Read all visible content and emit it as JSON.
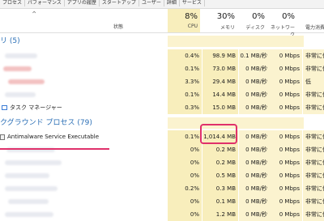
{
  "tabs": [
    "プロセス",
    "パフォーマンス",
    "アプリの履歴",
    "スタートアップ",
    "ユーザー",
    "詳細",
    "サービス"
  ],
  "header": {
    "status_label": "状態",
    "cpu": {
      "pct": "8%",
      "label": "CPU"
    },
    "memory": {
      "pct": "30%",
      "label": "メモリ"
    },
    "disk": {
      "pct": "0%",
      "label": "ディスク"
    },
    "network": {
      "pct": "0%",
      "label": "ネットワーク"
    },
    "power": {
      "label": "電力消費"
    }
  },
  "groups": {
    "apps": "リ (5)",
    "background": "クグラウンド プロセス (79)"
  },
  "app_rows": [
    {
      "name": "",
      "cpu": "0.4%",
      "mem": "98.9 MB",
      "disk": "0.1 MB/秒",
      "net": "0 Mbps",
      "power": "非常に低"
    },
    {
      "name": "",
      "cpu": "0.1%",
      "mem": "73.0 MB",
      "disk": "0 MB/秒",
      "net": "0 Mbps",
      "power": "非常に低"
    },
    {
      "name": "",
      "cpu": "3.3%",
      "mem": "29.4 MB",
      "disk": "0 MB/秒",
      "net": "0 Mbps",
      "power": "低"
    },
    {
      "name": "",
      "cpu": "0.1%",
      "mem": "14.4 MB",
      "disk": "0 MB/秒",
      "net": "0 Mbps",
      "power": "非常に低"
    },
    {
      "name": "タスク マネージャー",
      "cpu": "0.3%",
      "mem": "15.0 MB",
      "disk": "0 MB/秒",
      "net": "0 Mbps",
      "power": "非常に低"
    }
  ],
  "bg_rows": [
    {
      "name": "Antimalware Service Executable",
      "cpu": "0.1%",
      "mem": "1,014.4 MB",
      "disk": "0 MB/秒",
      "net": "0 Mbps",
      "power": "非常に低"
    },
    {
      "name": "",
      "cpu": "0%",
      "mem": "0.2 MB",
      "disk": "0 MB/秒",
      "net": "0 Mbps",
      "power": "非常に低"
    },
    {
      "name": "",
      "cpu": "0%",
      "mem": "0.2 MB",
      "disk": "0 MB/秒",
      "net": "0 Mbps",
      "power": "非常に低"
    },
    {
      "name": "",
      "cpu": "0%",
      "mem": "0.5 MB",
      "disk": "0 MB/秒",
      "net": "0 Mbps",
      "power": "非常に低"
    },
    {
      "name": "",
      "cpu": "0.2%",
      "mem": "0.3 MB",
      "disk": "0 MB/秒",
      "net": "0 Mbps",
      "power": "非常に低"
    },
    {
      "name": "",
      "cpu": "0%",
      "mem": "0.1 MB",
      "disk": "0 MB/秒",
      "net": "0 Mbps",
      "power": "非常に低"
    },
    {
      "name": "",
      "cpu": "0%",
      "mem": "1.2 MB",
      "disk": "0 MB/秒",
      "net": "0 Mbps",
      "power": "非常に低"
    }
  ],
  "colors": {
    "accent": "#e0316b",
    "link": "#2b6fb6",
    "heat": "#f8eebc"
  }
}
